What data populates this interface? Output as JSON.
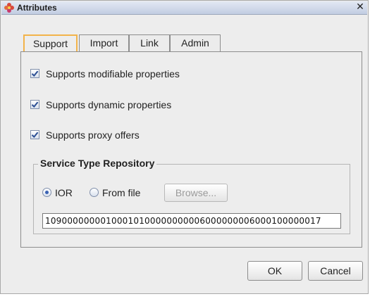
{
  "window": {
    "title": "Attributes",
    "close_glyph": "✕"
  },
  "tabs": [
    {
      "label": "Support",
      "active": true
    },
    {
      "label": "Import",
      "active": false
    },
    {
      "label": "Link",
      "active": false
    },
    {
      "label": "Admin",
      "active": false
    }
  ],
  "support": {
    "checkboxes": [
      {
        "label": "Supports modifiable properties",
        "checked": true
      },
      {
        "label": "Supports dynamic properties",
        "checked": true
      },
      {
        "label": "Supports proxy offers",
        "checked": true
      }
    ],
    "repository": {
      "title": "Service Type Repository",
      "options": [
        {
          "label": "IOR",
          "selected": true
        },
        {
          "label": "From file",
          "selected": false
        }
      ],
      "browse_label": "Browse...",
      "ior_value": "10900000000100010100000000006000000006000100000017"
    }
  },
  "footer": {
    "ok_label": "OK",
    "cancel_label": "Cancel"
  },
  "colors": {
    "active_tab_border": "#f2b34a",
    "check_mark": "#2c4f94",
    "radio_dot": "#3a62b3"
  },
  "icons": {
    "app": "flower-app-icon",
    "close": "close-icon"
  }
}
